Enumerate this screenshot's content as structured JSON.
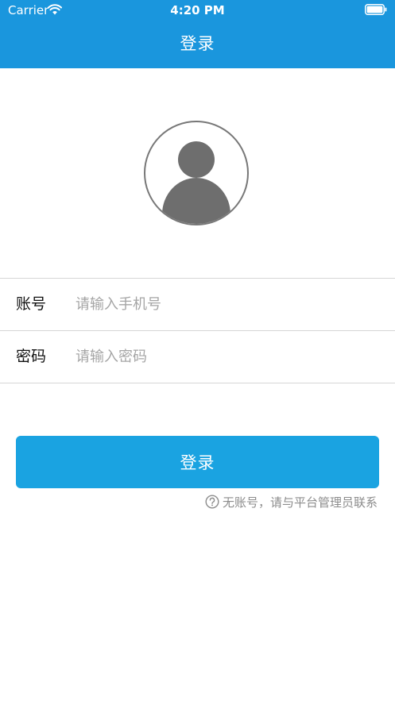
{
  "status_bar": {
    "carrier": "Carrier",
    "time": "4:20 PM",
    "wifi_icon": "wifi-icon",
    "battery_icon": "battery-icon"
  },
  "nav": {
    "title": "登录"
  },
  "avatar": {
    "icon": "user-avatar-icon"
  },
  "form": {
    "account": {
      "label": "账号",
      "placeholder": "请输入手机号",
      "value": ""
    },
    "password": {
      "label": "密码",
      "placeholder": "请输入密码",
      "value": ""
    }
  },
  "login_button": {
    "label": "登录"
  },
  "hint": {
    "icon": "question-circle-icon",
    "text": "无账号，请与平台管理员联系"
  },
  "colors": {
    "header": "#1a96dd",
    "button": "#1aa3e1",
    "hint_text": "#8c8c8c",
    "placeholder": "#a5a5a5",
    "divider": "#d6d6d6"
  }
}
